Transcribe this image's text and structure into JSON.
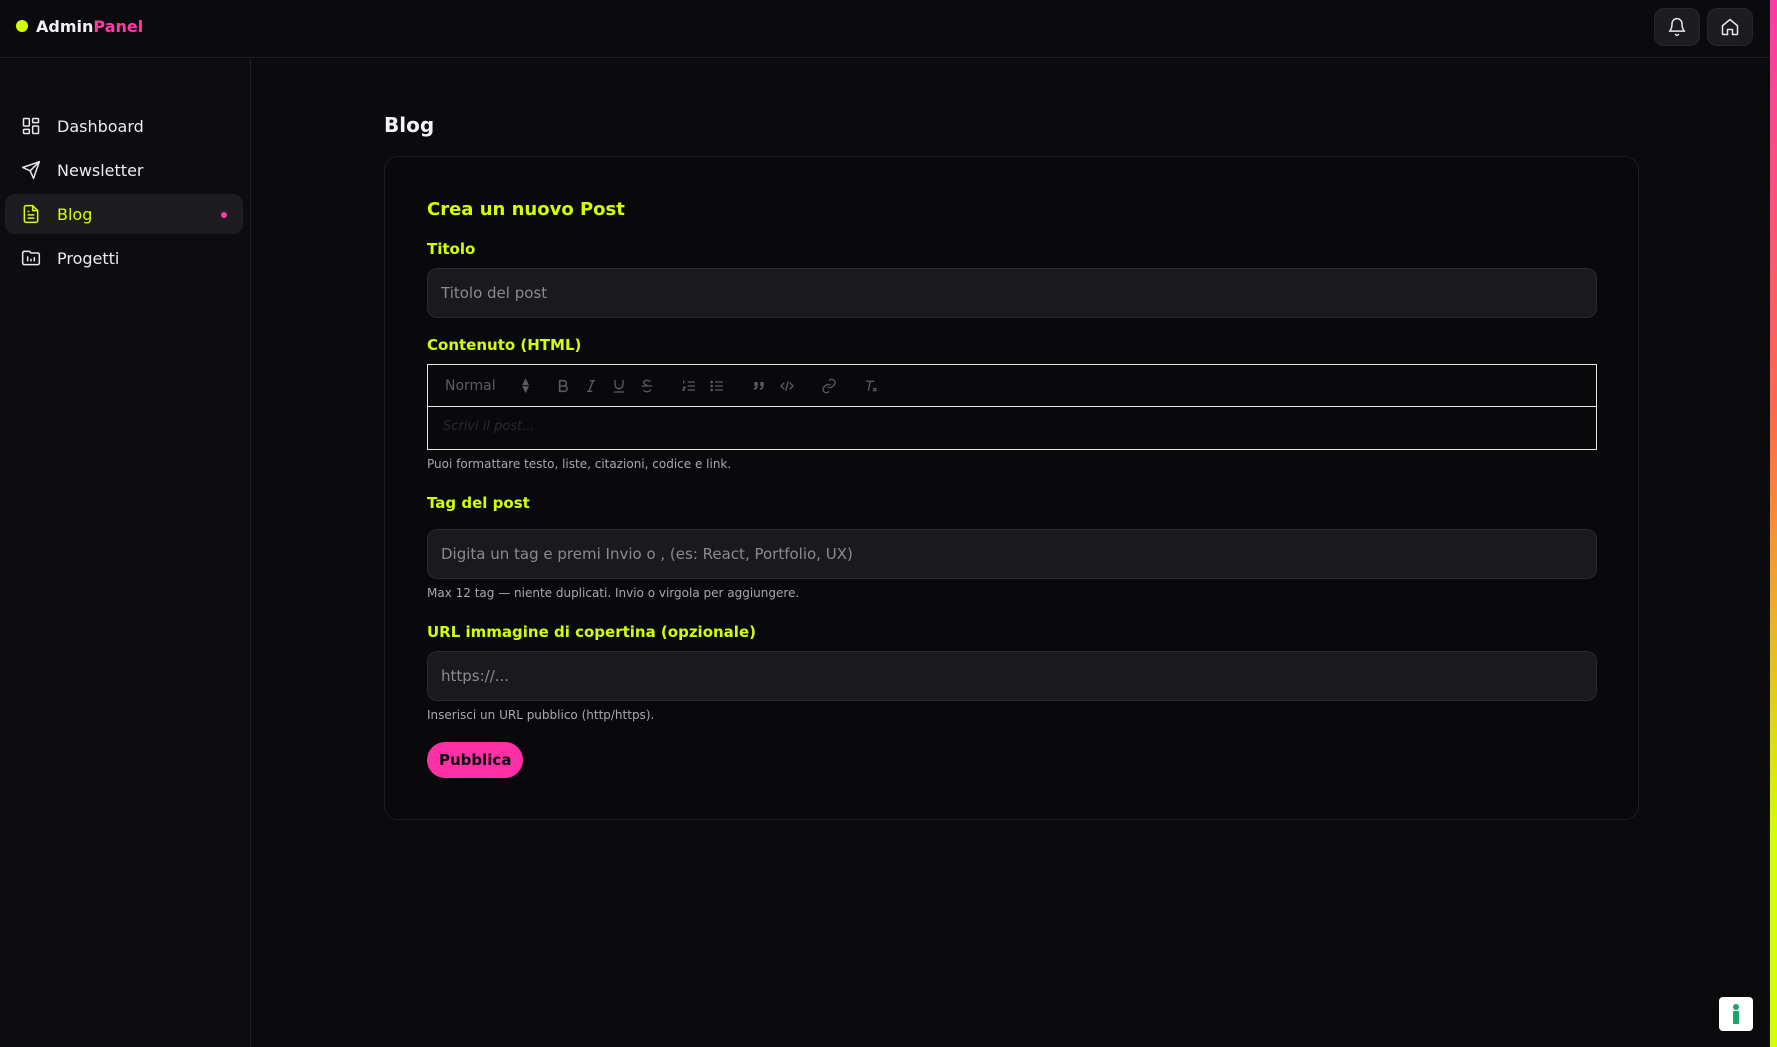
{
  "app": {
    "brand_part1": "Admin",
    "brand_part2": "Panel"
  },
  "topbar": {
    "icons": [
      "bell-icon",
      "home-icon"
    ]
  },
  "sidebar": {
    "items": [
      {
        "label": "Dashboard",
        "icon": "dashboard-grid-icon",
        "active": false
      },
      {
        "label": "Newsletter",
        "icon": "send-icon",
        "active": false
      },
      {
        "label": "Blog",
        "icon": "document-icon",
        "active": true
      },
      {
        "label": "Progetti",
        "icon": "folder-chart-icon",
        "active": false
      }
    ]
  },
  "main": {
    "page_title": "Blog",
    "card_title": "Crea un nuovo Post",
    "title_field": {
      "label": "Titolo",
      "placeholder": "Titolo del post"
    },
    "content_field": {
      "label": "Contenuto (HTML)",
      "toolbar": {
        "heading_select": "Normal"
      },
      "editor_placeholder": "Scrivi il post...",
      "hint": "Puoi formattare testo, liste, citazioni, codice e link."
    },
    "tags_field": {
      "label": "Tag del post",
      "placeholder": "Digita un tag e premi Invio o , (es: React, Portfolio, UX)",
      "hint": "Max 12 tag — niente duplicati. Invio o virgola per aggiungere."
    },
    "cover_field": {
      "label": "URL immagine di copertina (opzionale)",
      "placeholder": "https://...",
      "hint": "Inserisci un URL pubblico (http/https)."
    },
    "publish_label": "Pubblica"
  },
  "colors": {
    "accent_lime": "#d4ff00",
    "accent_pink": "#ff3aa8",
    "background": "#0b0b0e"
  }
}
